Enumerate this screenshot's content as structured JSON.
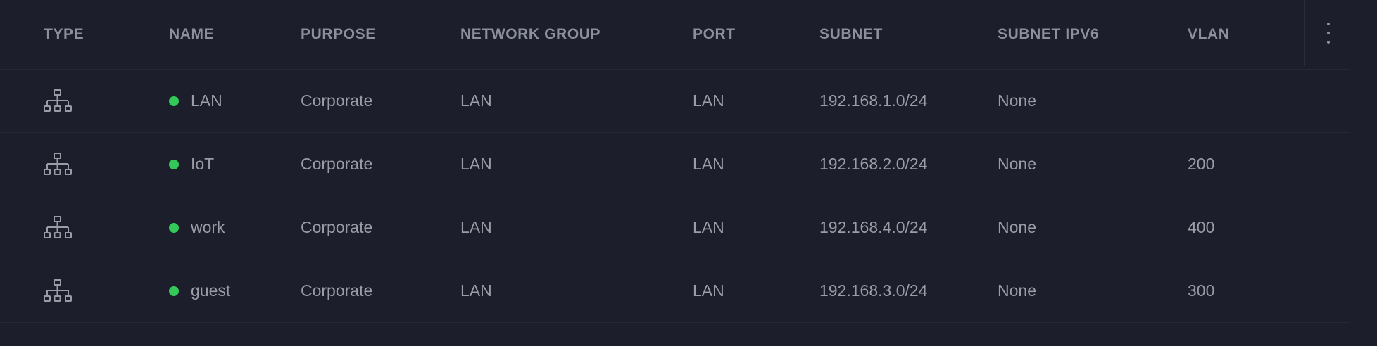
{
  "columns": {
    "type": "TYPE",
    "name": "NAME",
    "purpose": "PURPOSE",
    "network_group": "NETWORK GROUP",
    "port": "PORT",
    "subnet": "SUBNET",
    "subnet_ipv6": "SUBNET IPV6",
    "vlan": "VLAN"
  },
  "rows": [
    {
      "type_icon": "network-topology-icon",
      "status": "active",
      "name": "LAN",
      "purpose": "Corporate",
      "network_group": "LAN",
      "port": "LAN",
      "subnet": "192.168.1.0/24",
      "subnet_ipv6": "None",
      "vlan": ""
    },
    {
      "type_icon": "network-topology-icon",
      "status": "active",
      "name": "IoT",
      "purpose": "Corporate",
      "network_group": "LAN",
      "port": "LAN",
      "subnet": "192.168.2.0/24",
      "subnet_ipv6": "None",
      "vlan": "200"
    },
    {
      "type_icon": "network-topology-icon",
      "status": "active",
      "name": "work",
      "purpose": "Corporate",
      "network_group": "LAN",
      "port": "LAN",
      "subnet": "192.168.4.0/24",
      "subnet_ipv6": "None",
      "vlan": "400"
    },
    {
      "type_icon": "network-topology-icon",
      "status": "active",
      "name": "guest",
      "purpose": "Corporate",
      "network_group": "LAN",
      "port": "LAN",
      "subnet": "192.168.3.0/24",
      "subnet_ipv6": "None",
      "vlan": "300"
    }
  ],
  "colors": {
    "background": "#1c1e2b",
    "status_active": "#34c759",
    "divider": "#262837",
    "text": "#9a9ca6"
  },
  "icons": {
    "menu": "more-vertical-icon"
  }
}
